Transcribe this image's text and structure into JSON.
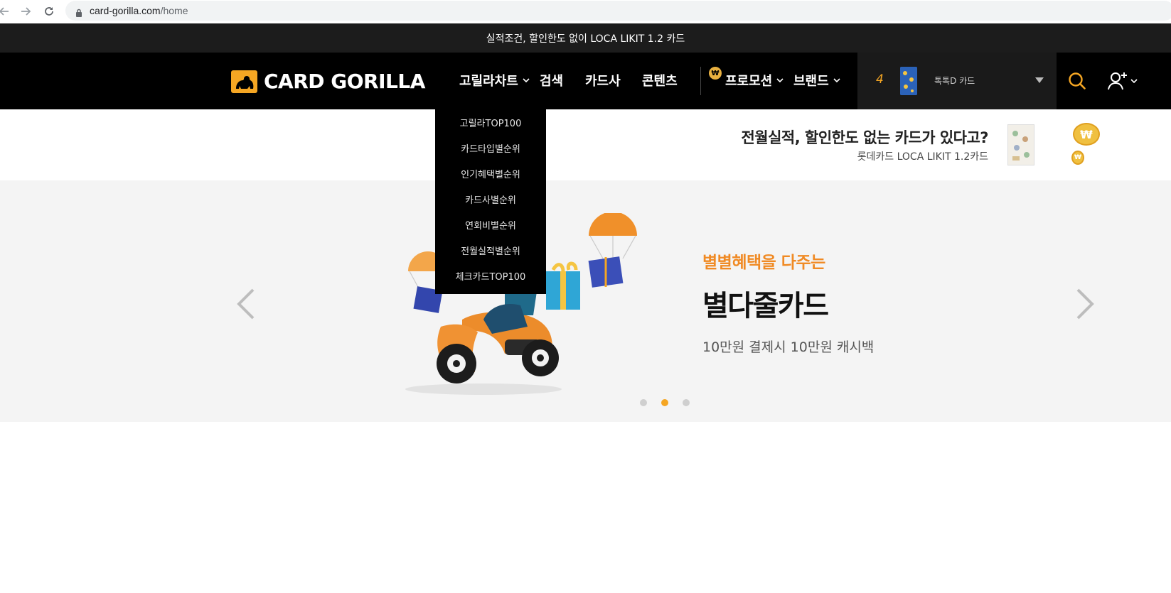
{
  "browser": {
    "url_domain": "card-gorilla.com",
    "url_path": "/home"
  },
  "top_banner": {
    "text": "실적조건, 할인한도 없이 LOCA LIKIT 1.2 카드"
  },
  "header": {
    "logo_text": "CARD GORILLA",
    "nav": [
      {
        "label": "고릴라차트",
        "has_dropdown": true
      },
      {
        "label": "검색",
        "has_dropdown": false
      },
      {
        "label": "카드사",
        "has_dropdown": false
      },
      {
        "label": "콘텐츠",
        "has_dropdown": false
      },
      {
        "label": "프로모션",
        "has_dropdown": true
      },
      {
        "label": "브랜드",
        "has_dropdown": true
      }
    ],
    "promo_badge": "₩",
    "ranking": {
      "rank": "4",
      "card_name": "톡톡D 카드"
    }
  },
  "dropdown": {
    "items": [
      "고릴라TOP100",
      "카드타입별순위",
      "인기혜택별순위",
      "카드사별순위",
      "연회비별순위",
      "전월실적별순위",
      "체크카드TOP100"
    ]
  },
  "ad": {
    "title": "전월실적, 할인한도 없는 카드가 있다고?",
    "subtitle": "롯데카드 LOCA LIKIT 1.2카드",
    "coin_symbol": "₩"
  },
  "hero": {
    "eyebrow": "별별혜택을 다주는",
    "title": "별다줄카드",
    "description": "10만원 결제시 10만원 캐시백",
    "slides_count": 3,
    "active_slide": 2
  },
  "colors": {
    "accent": "#f5a623",
    "header_bg": "#000000",
    "banner_bg": "#1c1c1c",
    "hero_bg": "#f4f4f4",
    "eyebrow": "#f08a24"
  }
}
